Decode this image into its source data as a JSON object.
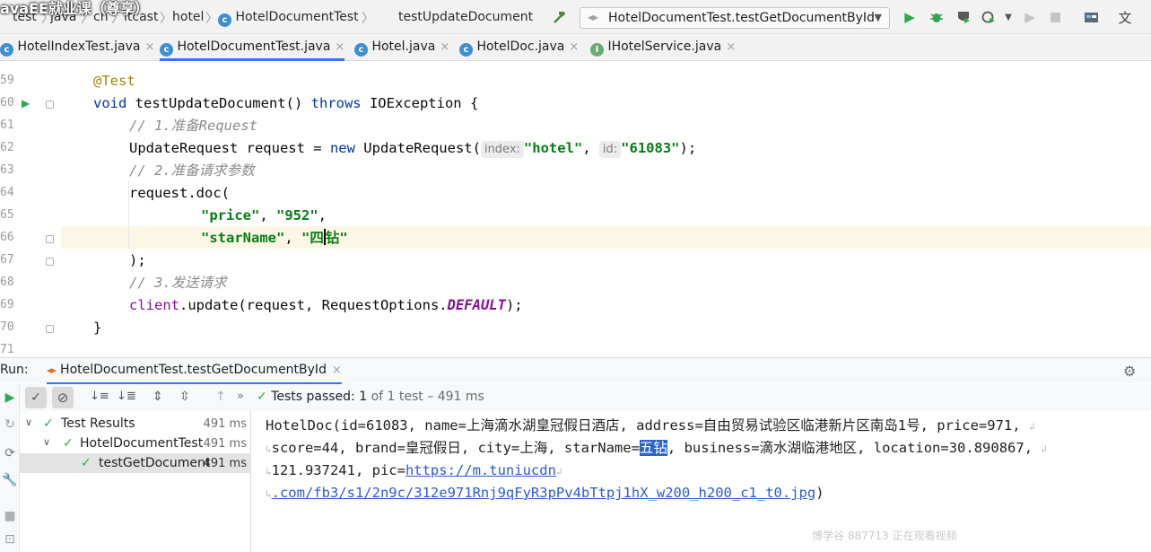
{
  "overlay_title": "avaEE就业课（尊享）",
  "breadcrumb": [
    "test",
    "java",
    "cn",
    "itcast",
    "hotel",
    "HotelDocumentTest",
    "testUpdateDocument"
  ],
  "run_config": "HotelDocumentTest.testGetDocumentById",
  "tabs": [
    {
      "label": "HotelIndexTest.java",
      "icon": "class-icon"
    },
    {
      "label": "HotelDocumentTest.java",
      "icon": "class-icon",
      "active": true
    },
    {
      "label": "Hotel.java",
      "icon": "class-icon"
    },
    {
      "label": "HotelDoc.java",
      "icon": "class-icon"
    },
    {
      "label": "IHotelService.java",
      "icon": "interface-icon"
    }
  ],
  "editor": {
    "line_numbers": [
      "59",
      "60",
      "61",
      "62",
      "63",
      "64",
      "65",
      "66",
      "67",
      "68",
      "69",
      "70",
      "71"
    ],
    "annotation": "@Test",
    "method_void": "void",
    "method_sig": " testUpdateDocument() ",
    "throws_kw": "throws",
    "method_exc": " IOException {",
    "comment1": "// 1.准备Request",
    "req_type": "UpdateRequest request = ",
    "new_kw": "new",
    "req_ctor": " UpdateRequest(",
    "hint_index": "index:",
    "arg_index": "\"hotel\"",
    "comma": ", ",
    "hint_id": "id:",
    "arg_id": "\"61083\"",
    "req_end": ");",
    "comment2": "// 2.准备请求参数",
    "doc_call": "request.doc(",
    "price_key": "\"price\"",
    "price_val": "\"952\"",
    "star_key": "\"starName\"",
    "star_val_a": "\"四",
    "star_val_b": "钻\"",
    "close_paren": ");",
    "comment3": "// 3.发送请求",
    "client_kw": "client",
    "update_call": ".update(request, RequestOptions.",
    "default_kw": "DEFAULT",
    "update_end": ");",
    "close_brace": "}"
  },
  "run_panel": {
    "label": "Run:",
    "tab": "HotelDocumentTest.testGetDocumentById",
    "status_passed": "Tests passed:",
    "status_count": "1",
    "status_rest": "of 1 test – 491 ms"
  },
  "tree": [
    {
      "label": "Test Results",
      "time": "491 ms"
    },
    {
      "label": "HotelDocumentTest",
      "time": "491 ms"
    },
    {
      "label": "testGetDocument",
      "time": "491 ms"
    }
  ],
  "console": {
    "line1": "HotelDoc(id=61083, name=上海滴水湖皇冠假日酒店, address=自由贸易试验区临港新片区南岛1号, price=971,",
    "line2a": "score=44, brand=皇冠假日, city=上海, starName=",
    "line2b": "五钻",
    "line2c": ", business=滴水湖临港地区, location=30.890867,",
    "line3a": "121.937241, pic=",
    "line3b": "https://m.tuniucdn",
    "line4a": ".com/fb3/s1/2n9c/312e971Rnj9qFyR3pPv4bTtpj1hX_w200_h200_c1_t0.jpg",
    "line4b": ")"
  },
  "watermark": "博学谷 887713 正在观看视频"
}
